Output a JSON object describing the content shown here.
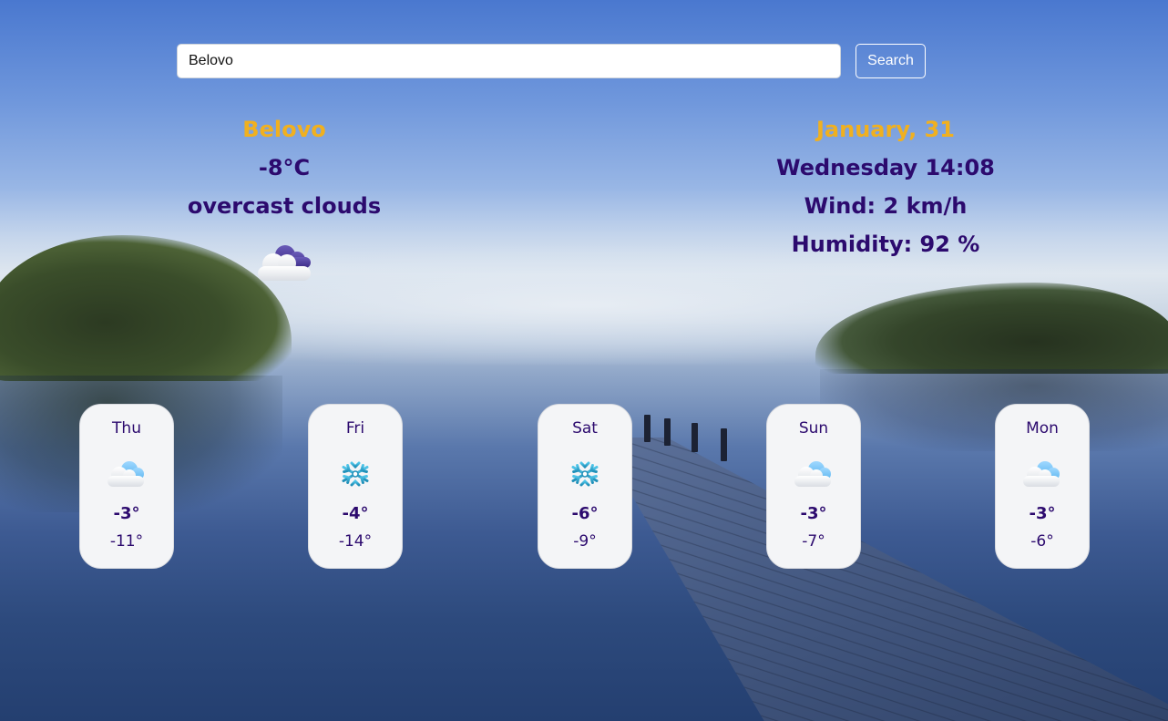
{
  "search": {
    "value": "Belovo",
    "button_label": "Search"
  },
  "current": {
    "city": "Belovo",
    "temperature": "-8°C",
    "description": "overcast clouds",
    "icon": "overcast-clouds-icon"
  },
  "details": {
    "date": "January, 31",
    "day_time": "Wednesday 14:08",
    "wind": "Wind: 2 km/h",
    "humidity": "Humidity: 92 %"
  },
  "forecast": [
    {
      "day": "Thu",
      "icon": "cloud-icon",
      "max": "-3°",
      "min": "-11°"
    },
    {
      "day": "Fri",
      "icon": "snowflake-icon",
      "max": "-4°",
      "min": "-14°"
    },
    {
      "day": "Sat",
      "icon": "snowflake-icon",
      "max": "-6°",
      "min": "-9°"
    },
    {
      "day": "Sun",
      "icon": "cloud-icon",
      "max": "-3°",
      "min": "-7°"
    },
    {
      "day": "Mon",
      "icon": "cloud-icon",
      "max": "-3°",
      "min": "-6°"
    }
  ],
  "colors": {
    "accent": "#f0b020",
    "text": "#2c0a6e",
    "card_bg": "#f4f5f7"
  }
}
